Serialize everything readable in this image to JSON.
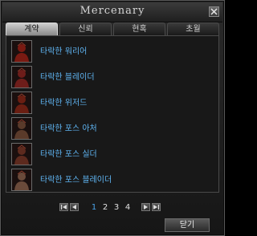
{
  "window": {
    "title": "Mercenary"
  },
  "tabs": [
    {
      "label": "계약",
      "active": true
    },
    {
      "label": "신뢰",
      "active": false
    },
    {
      "label": "현혹",
      "active": false
    },
    {
      "label": "초월",
      "active": false
    }
  ],
  "mercenaries": [
    {
      "name": "타락한 워리어",
      "portrait_tint": "#7a1a12"
    },
    {
      "name": "타락한 블레이더",
      "portrait_tint": "#6e1d1a"
    },
    {
      "name": "타락한 위저드",
      "portrait_tint": "#6a1e12"
    },
    {
      "name": "타락한 포스 아처",
      "portrait_tint": "#5a3a2a"
    },
    {
      "name": "타락한 포스 실더",
      "portrait_tint": "#5d2a1e"
    },
    {
      "name": "타락한 포스 블레이더",
      "portrait_tint": "#6a4a3a"
    }
  ],
  "pagination": {
    "pages": [
      "1",
      "2",
      "3",
      "4"
    ],
    "current": "1"
  },
  "footer": {
    "close_label": "닫기"
  },
  "colors": {
    "link": "#5fb4f2",
    "current_page": "#4aa3e8",
    "active_tab": "#bdbdbd"
  }
}
